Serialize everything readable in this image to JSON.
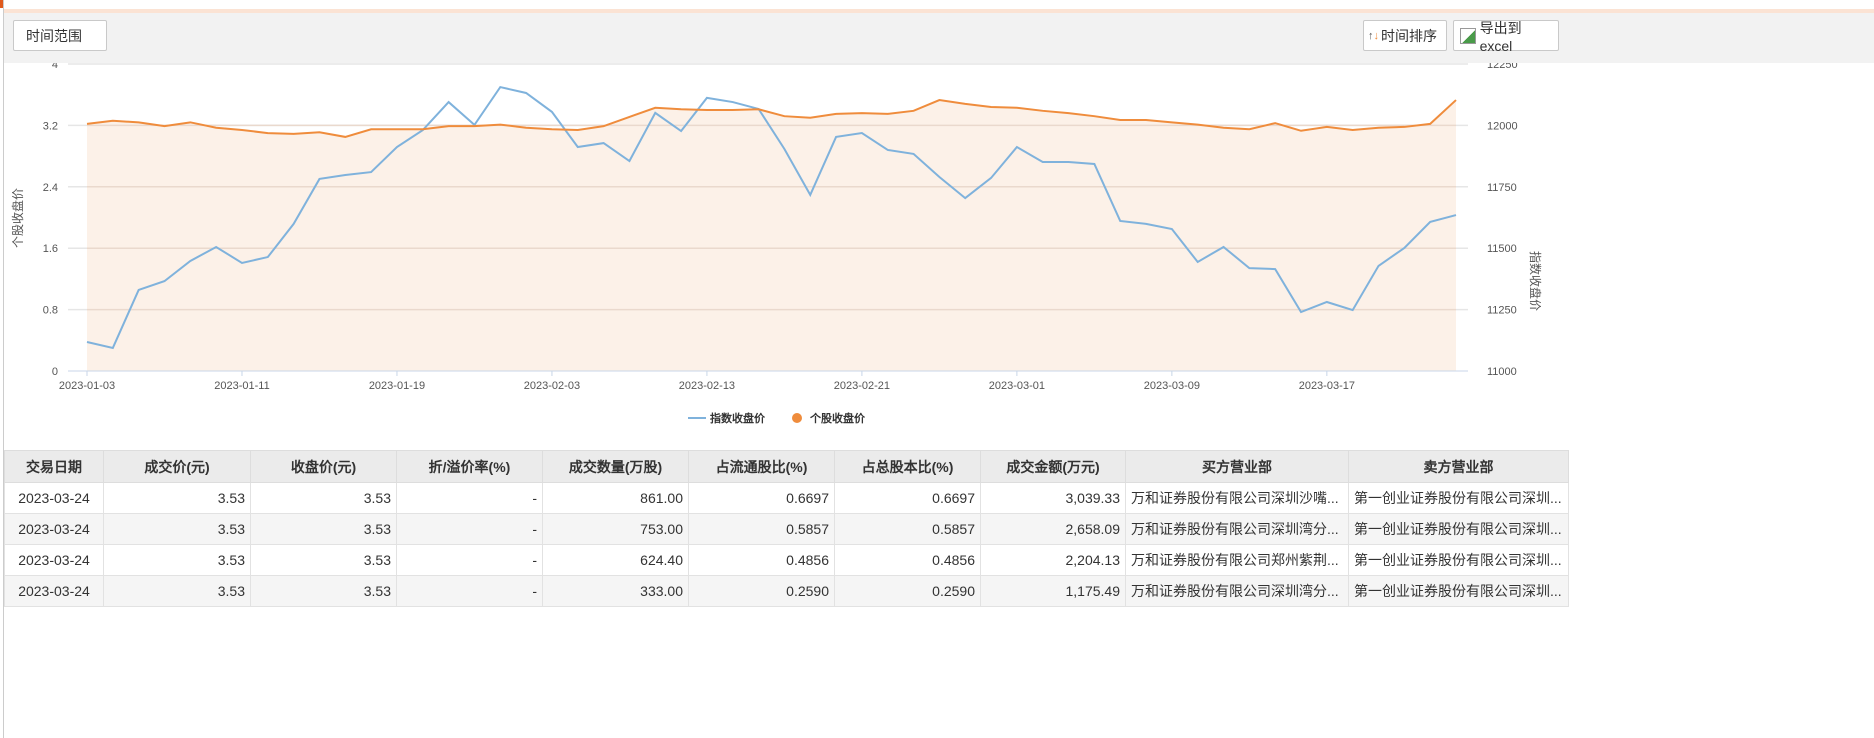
{
  "toolbar": {
    "time_range": "时间范围",
    "sort": "时间排序",
    "export": "导出到excel"
  },
  "colors": {
    "index": "#7fb2dc",
    "stock": "#ef8c3c",
    "fill": "#fcf1e8"
  },
  "chart_data": {
    "type": "line",
    "left_axis": {
      "label": "个股收盘价",
      "ticks": [
        "0",
        "0.8",
        "1.6",
        "2.4",
        "3.2",
        "4"
      ],
      "range": [
        0,
        4
      ]
    },
    "right_axis": {
      "label": "指数收盘价",
      "ticks": [
        "11000",
        "11250",
        "11500",
        "11750",
        "12000",
        "12250"
      ],
      "range": [
        11000,
        12250
      ]
    },
    "x_ticks": [
      "2023-01-03",
      "2023-01-11",
      "2023-01-19",
      "2023-02-03",
      "2023-02-13",
      "2023-02-21",
      "2023-03-01",
      "2023-03-09",
      "2023-03-17"
    ],
    "x_tick_every": 6,
    "legend": {
      "position": "bottom",
      "items": [
        "指数收盘价",
        "个股收盘价"
      ]
    },
    "series": [
      {
        "name": "指数收盘价",
        "axis": "right",
        "values": [
          11118,
          11094,
          11330,
          11366,
          11448,
          11505,
          11440,
          11464,
          11599,
          11782,
          11798,
          11810,
          11912,
          11981,
          12095,
          12002,
          12156,
          12132,
          12055,
          11912,
          11928,
          11855,
          12051,
          11977,
          12112,
          12095,
          12067,
          11904,
          11717,
          11953,
          11969,
          11900,
          11884,
          11790,
          11704,
          11786,
          11912,
          11851,
          11851,
          11843,
          11611,
          11599,
          11578,
          11444,
          11505,
          11419,
          11415,
          11240,
          11281,
          11248,
          11428,
          11501,
          11607,
          11635
        ]
      },
      {
        "name": "个股收盘价",
        "axis": "left",
        "area": true,
        "values": [
          3.22,
          3.26,
          3.24,
          3.19,
          3.24,
          3.17,
          3.14,
          3.1,
          3.09,
          3.11,
          3.05,
          3.15,
          3.15,
          3.15,
          3.19,
          3.19,
          3.21,
          3.17,
          3.15,
          3.14,
          3.19,
          3.31,
          3.43,
          3.41,
          3.4,
          3.4,
          3.41,
          3.32,
          3.3,
          3.35,
          3.36,
          3.35,
          3.39,
          3.53,
          3.48,
          3.44,
          3.43,
          3.39,
          3.36,
          3.32,
          3.27,
          3.27,
          3.24,
          3.21,
          3.17,
          3.15,
          3.23,
          3.13,
          3.18,
          3.14,
          3.17,
          3.18,
          3.22,
          3.53
        ]
      }
    ]
  },
  "table": {
    "headers": [
      "交易日期",
      "成交价(元)",
      "收盘价(元)",
      "折/溢价率(%)",
      "成交数量(万股)",
      "占流通股比(%)",
      "占总股本比(%)",
      "成交金额(万元)",
      "买方营业部",
      "卖方营业部"
    ],
    "rows": [
      [
        "2023-03-24",
        "3.53",
        "3.53",
        "-",
        "861.00",
        "0.6697",
        "0.6697",
        "3,039.33",
        "万和证券股份有限公司深圳沙嘴...",
        "第一创业证券股份有限公司深圳..."
      ],
      [
        "2023-03-24",
        "3.53",
        "3.53",
        "-",
        "753.00",
        "0.5857",
        "0.5857",
        "2,658.09",
        "万和证券股份有限公司深圳湾分...",
        "第一创业证券股份有限公司深圳..."
      ],
      [
        "2023-03-24",
        "3.53",
        "3.53",
        "-",
        "624.40",
        "0.4856",
        "0.4856",
        "2,204.13",
        "万和证券股份有限公司郑州紫荆...",
        "第一创业证券股份有限公司深圳..."
      ],
      [
        "2023-03-24",
        "3.53",
        "3.53",
        "-",
        "333.00",
        "0.2590",
        "0.2590",
        "1,175.49",
        "万和证券股份有限公司深圳湾分...",
        "第一创业证券股份有限公司深圳..."
      ]
    ]
  }
}
